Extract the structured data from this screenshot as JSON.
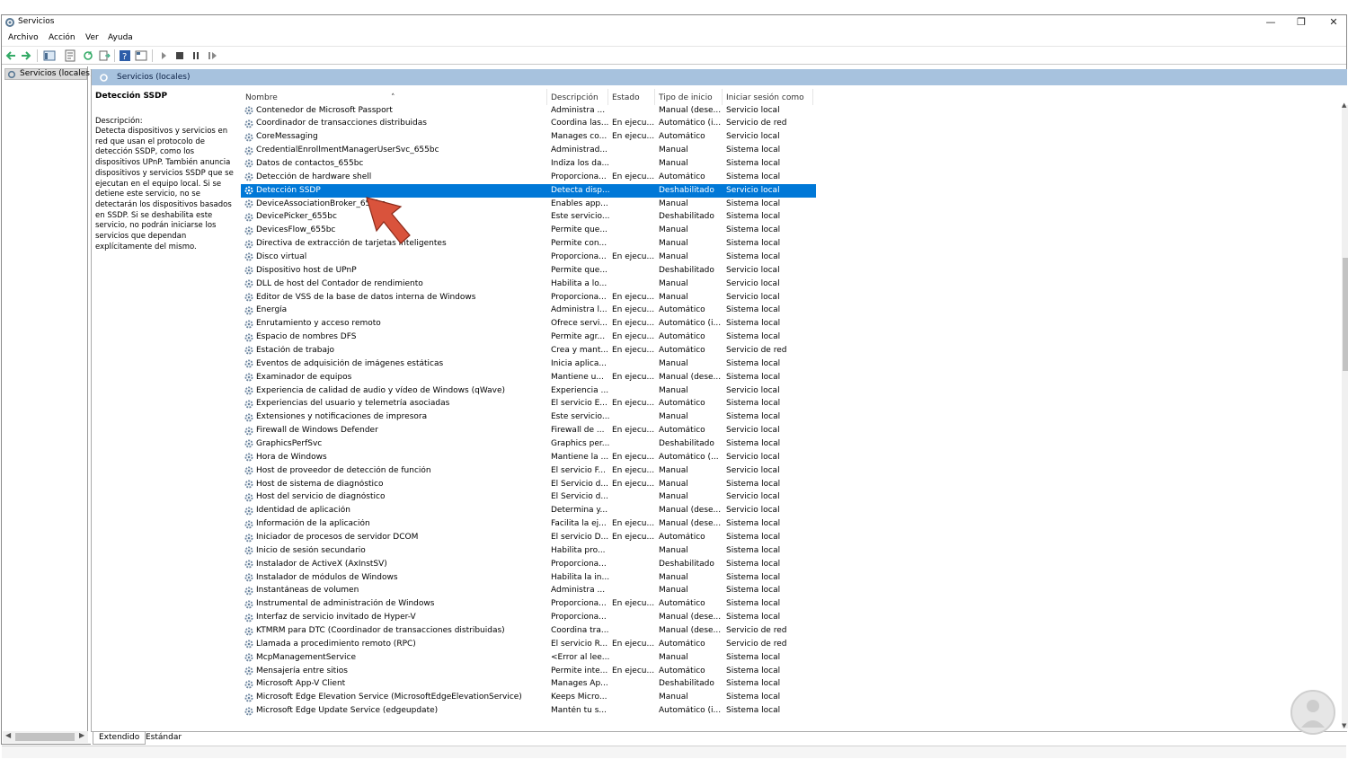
{
  "window": {
    "title": "Servicios",
    "menu": [
      "Archivo",
      "Acción",
      "Ver",
      "Ayuda"
    ]
  },
  "tree": {
    "root_label": "Servicios (locales)"
  },
  "content_header": "Servicios (locales)",
  "detail": {
    "title": "Detección SSDP",
    "description_label": "Descripción:",
    "description": "Detecta dispositivos y servicios en red que usan el protocolo de detección SSDP, como los dispositivos UPnP. También anuncia dispositivos y servicios SSDP que se ejecutan en el equipo local. Si se detiene este servicio, no se detectarán los dispositivos basados en SSDP. Si se deshabilita este servicio, no podrán iniciarse los servicios que dependan explícitamente del mismo."
  },
  "columns": [
    "Nombre",
    "Descripción",
    "Estado",
    "Tipo de inicio",
    "Iniciar sesión como"
  ],
  "selected_index": 6,
  "services": [
    [
      "Contenedor de Microsoft Passport",
      "Administra ...",
      "",
      "Manual (dese...",
      "Servicio local"
    ],
    [
      "Coordinador de transacciones distribuidas",
      "Coordina las...",
      "En ejecu...",
      "Automático (i...",
      "Servicio de red"
    ],
    [
      "CoreMessaging",
      "Manages co...",
      "En ejecu...",
      "Automático",
      "Servicio local"
    ],
    [
      "CredentialEnrollmentManagerUserSvc_655bc",
      "Administrad...",
      "",
      "Manual",
      "Sistema local"
    ],
    [
      "Datos de contactos_655bc",
      "Indiza los da...",
      "",
      "Manual",
      "Sistema local"
    ],
    [
      "Detección de hardware shell",
      "Proporciona...",
      "En ejecu...",
      "Automático",
      "Sistema local"
    ],
    [
      "Detección SSDP",
      "Detecta disp...",
      "",
      "Deshabilitado",
      "Servicio local"
    ],
    [
      "DeviceAssociationBroker_655bc",
      "Enables app...",
      "",
      "Manual",
      "Sistema local"
    ],
    [
      "DevicePicker_655bc",
      "Este servicio...",
      "",
      "Deshabilitado",
      "Sistema local"
    ],
    [
      "DevicesFlow_655bc",
      "Permite que...",
      "",
      "Manual",
      "Sistema local"
    ],
    [
      "Directiva de extracción de tarjetas inteligentes",
      "Permite con...",
      "",
      "Manual",
      "Sistema local"
    ],
    [
      "Disco virtual",
      "Proporciona...",
      "En ejecu...",
      "Manual",
      "Sistema local"
    ],
    [
      "Dispositivo host de UPnP",
      "Permite que...",
      "",
      "Deshabilitado",
      "Servicio local"
    ],
    [
      "DLL de host del Contador de rendimiento",
      "Habilita a lo...",
      "",
      "Manual",
      "Servicio local"
    ],
    [
      "Editor de VSS de la base de datos interna de Windows",
      "Proporciona...",
      "En ejecu...",
      "Manual",
      "Servicio local"
    ],
    [
      "Energía",
      "Administra l...",
      "En ejecu...",
      "Automático",
      "Sistema local"
    ],
    [
      "Enrutamiento y acceso remoto",
      "Ofrece servi...",
      "En ejecu...",
      "Automático (i...",
      "Sistema local"
    ],
    [
      "Espacio de nombres DFS",
      "Permite agr...",
      "En ejecu...",
      "Automático",
      "Sistema local"
    ],
    [
      "Estación de trabajo",
      "Crea y mant...",
      "En ejecu...",
      "Automático",
      "Servicio de red"
    ],
    [
      "Eventos de adquisición de imágenes estáticas",
      "Inicia aplica...",
      "",
      "Manual",
      "Sistema local"
    ],
    [
      "Examinador de equipos",
      "Mantiene u...",
      "En ejecu...",
      "Manual (dese...",
      "Sistema local"
    ],
    [
      "Experiencia de calidad de audio y vídeo de Windows (qWave)",
      "Experiencia ...",
      "",
      "Manual",
      "Servicio local"
    ],
    [
      "Experiencias del usuario y telemetría asociadas",
      "El servicio E...",
      "En ejecu...",
      "Automático",
      "Sistema local"
    ],
    [
      "Extensiones y notificaciones de impresora",
      "Este servicio...",
      "",
      "Manual",
      "Sistema local"
    ],
    [
      "Firewall de Windows Defender",
      "Firewall de ...",
      "En ejecu...",
      "Automático",
      "Servicio local"
    ],
    [
      "GraphicsPerfSvc",
      "Graphics per...",
      "",
      "Deshabilitado",
      "Sistema local"
    ],
    [
      "Hora de Windows",
      "Mantiene la ...",
      "En ejecu...",
      "Automático (...",
      "Servicio local"
    ],
    [
      "Host de proveedor de detección de función",
      "El servicio F...",
      "En ejecu...",
      "Manual",
      "Servicio local"
    ],
    [
      "Host de sistema de diagnóstico",
      "El Servicio d...",
      "En ejecu...",
      "Manual",
      "Sistema local"
    ],
    [
      "Host del servicio de diagnóstico",
      "El Servicio d...",
      "",
      "Manual",
      "Servicio local"
    ],
    [
      "Identidad de aplicación",
      "Determina y...",
      "",
      "Manual (dese...",
      "Servicio local"
    ],
    [
      "Información de la aplicación",
      "Facilita la ej...",
      "En ejecu...",
      "Manual (dese...",
      "Sistema local"
    ],
    [
      "Iniciador de procesos de servidor DCOM",
      "El servicio D...",
      "En ejecu...",
      "Automático",
      "Sistema local"
    ],
    [
      "Inicio de sesión secundario",
      "Habilita pro...",
      "",
      "Manual",
      "Sistema local"
    ],
    [
      "Instalador de ActiveX (AxInstSV)",
      "Proporciona...",
      "",
      "Deshabilitado",
      "Sistema local"
    ],
    [
      "Instalador de módulos de Windows",
      "Habilita la in...",
      "",
      "Manual",
      "Sistema local"
    ],
    [
      "Instantáneas de volumen",
      "Administra ...",
      "",
      "Manual",
      "Sistema local"
    ],
    [
      "Instrumental de administración de Windows",
      "Proporciona...",
      "En ejecu...",
      "Automático",
      "Sistema local"
    ],
    [
      "Interfaz de servicio invitado de Hyper-V",
      "Proporciona...",
      "",
      "Manual (dese...",
      "Sistema local"
    ],
    [
      "KTMRM para DTC (Coordinador de transacciones distribuidas)",
      "Coordina tra...",
      "",
      "Manual (dese...",
      "Servicio de red"
    ],
    [
      "Llamada a procedimiento remoto (RPC)",
      "El servicio R...",
      "En ejecu...",
      "Automático",
      "Servicio de red"
    ],
    [
      "McpManagementService",
      "<Error al lee...",
      "",
      "Manual",
      "Sistema local"
    ],
    [
      "Mensajería entre sitios",
      "Permite inte...",
      "En ejecu...",
      "Automático",
      "Sistema local"
    ],
    [
      "Microsoft App-V Client",
      "Manages Ap...",
      "",
      "Deshabilitado",
      "Sistema local"
    ],
    [
      "Microsoft Edge Elevation Service (MicrosoftEdgeElevationService)",
      "Keeps Micro...",
      "",
      "Manual",
      "Sistema local"
    ],
    [
      "Microsoft Edge Update Service (edgeupdate)",
      "Mantén tu s...",
      "",
      "Automático (i...",
      "Sistema local"
    ]
  ],
  "tabs": [
    "Extendido",
    "Estándar"
  ],
  "colors": {
    "selection": "#0078d7",
    "header": "#a7c2de",
    "arrow": "#d9533c"
  }
}
